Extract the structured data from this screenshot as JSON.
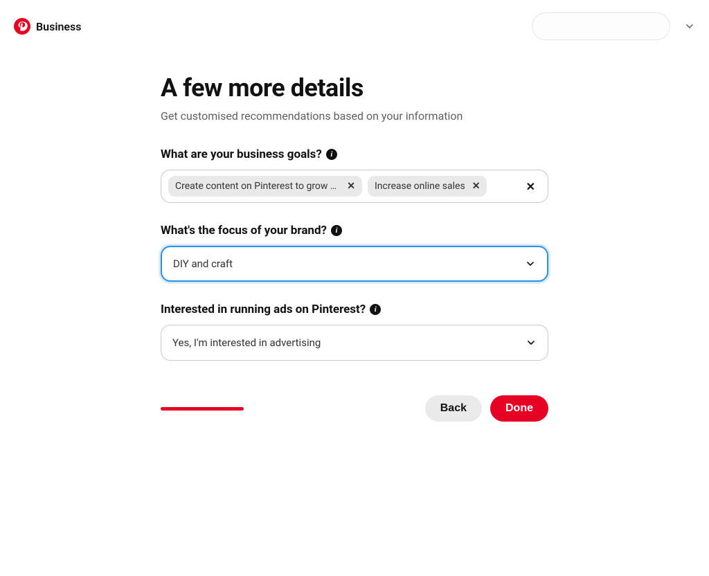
{
  "header": {
    "brand": "Business",
    "logo_color": "#e60023"
  },
  "page": {
    "title": "A few more details",
    "subtitle": "Get customised recommendations based on your information"
  },
  "goals": {
    "label": "What are your business goals?",
    "chips": [
      {
        "text": "Create content on Pinterest to grow an a..."
      },
      {
        "text": "Increase online sales"
      }
    ]
  },
  "brand_focus": {
    "label": "What's the focus of your brand?",
    "value": "DIY and craft"
  },
  "ads": {
    "label": "Interested in running ads on Pinterest?",
    "value": "Yes, I'm interested in advertising"
  },
  "footer": {
    "back": "Back",
    "done": "Done"
  }
}
